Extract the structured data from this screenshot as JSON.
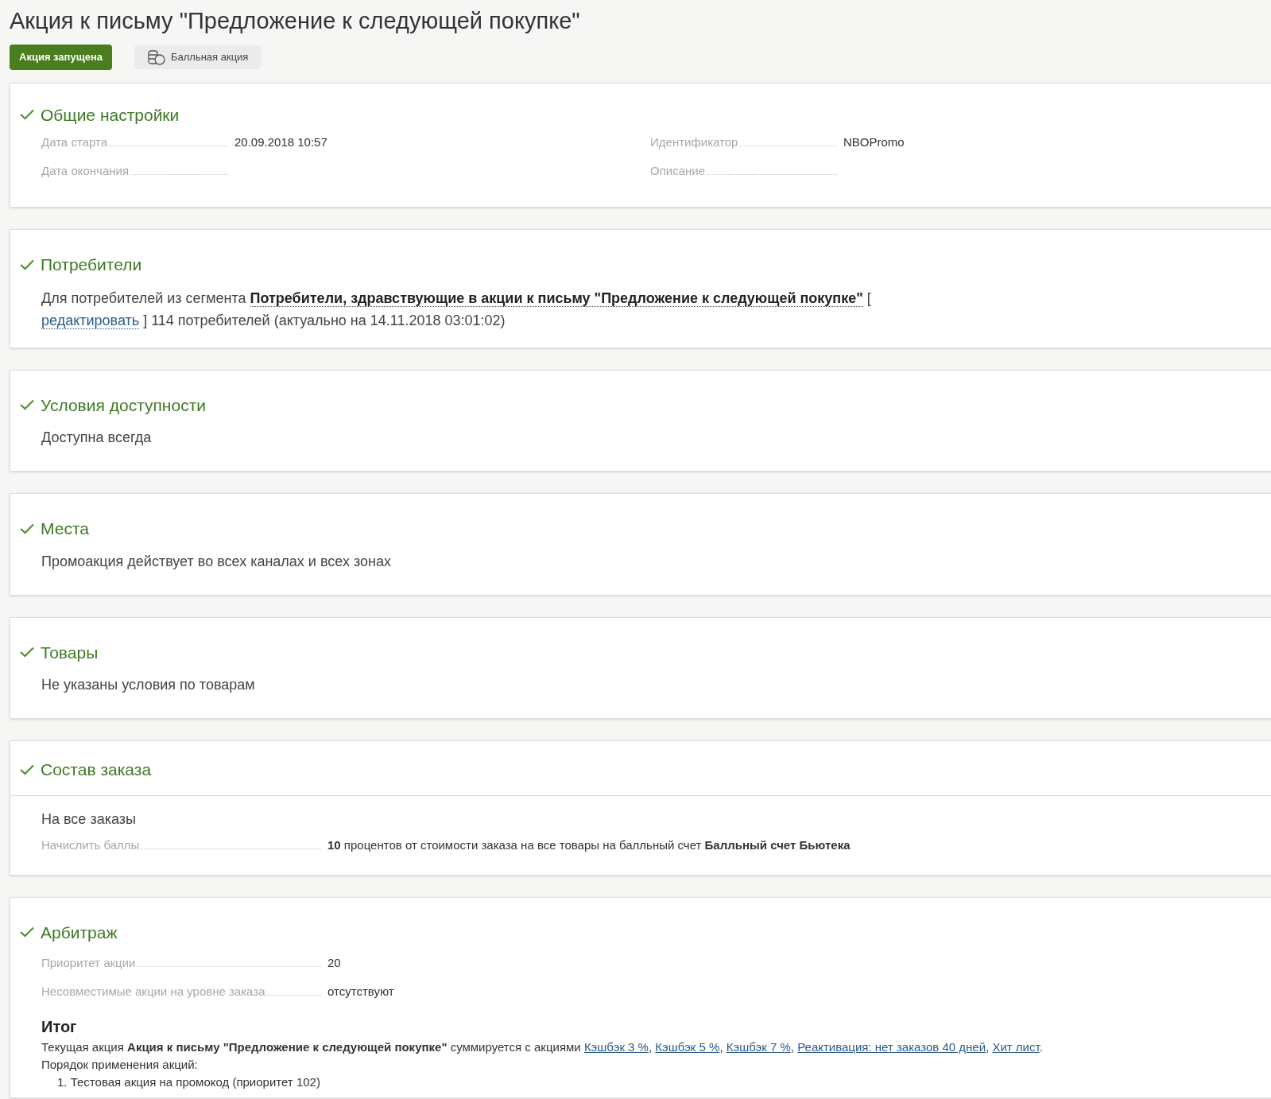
{
  "title": "Акция к письму \"Предложение к следующей покупке\"",
  "status_badge": "Акция запущена",
  "type_badge": "Балльная акция",
  "sections": [
    {
      "kind": "fields",
      "title": "Общие настройки",
      "columns": [
        [
          {
            "label": "Дата старта",
            "value": "20.09.2018 10:57"
          },
          {
            "label": "Дата окончания"
          }
        ],
        [
          {
            "label": "Идентификатор",
            "value": "NBOPromo"
          },
          {
            "label": "Описание"
          }
        ]
      ]
    },
    {
      "kind": "segment",
      "title": "Потребители",
      "prefix": "Для потребителей из сегмента",
      "segment": "Потребители, здравствующие в акции к письму \"Предложение к следующей покупке\"",
      "open_bracket": "[",
      "edit_link": "редактировать",
      "suffix": "] 114 потребителей (актуально на 14.11.2018 03:01:02)"
    },
    {
      "kind": "text",
      "title": "Условия доступности",
      "text": "Доступна всегда"
    },
    {
      "kind": "text",
      "title": "Места",
      "text": "Промоакция действует во всех каналах и всех зонах"
    },
    {
      "kind": "text",
      "title": "Товары",
      "text": "Не указаны условия по товарам"
    },
    {
      "kind": "order",
      "title": "Состав заказа",
      "text": "На все заказы",
      "fields": [
        {
          "label": "Начислить баллы",
          "value": "**10** процентов от стоимости заказа на все товары на балльный счет **Балльный счет Бьютека**"
        }
      ]
    },
    {
      "kind": "arbitrage",
      "title": "Арбитраж",
      "fields": [
        {
          "label": "Приоритет акции",
          "value": "20"
        },
        {
          "label": "Несовместимые акции на уровне заказа",
          "value": "отсутствуют"
        }
      ],
      "summary": {
        "heading": "Итог",
        "sentence": "Текущая акция **Акция к письму \"Предложение к следующей покупке\"** суммируется с акциями",
        "links": [
          {
            "text": "Кэшбэк 3 %",
            "after": ","
          },
          {
            "text": "Кэшбэк 5 %",
            "after": ","
          },
          {
            "text": "Кэшбэк 7 %",
            "after": ","
          },
          {
            "text": "Реактивация: нет заказов 40 дней",
            "after": ","
          },
          {
            "text": "Хит лист",
            "after": "."
          }
        ],
        "order_label": "Порядок применения акций:",
        "order": [
          "1. Тестовая акция на промокод (приоритет 102)"
        ]
      }
    }
  ]
}
